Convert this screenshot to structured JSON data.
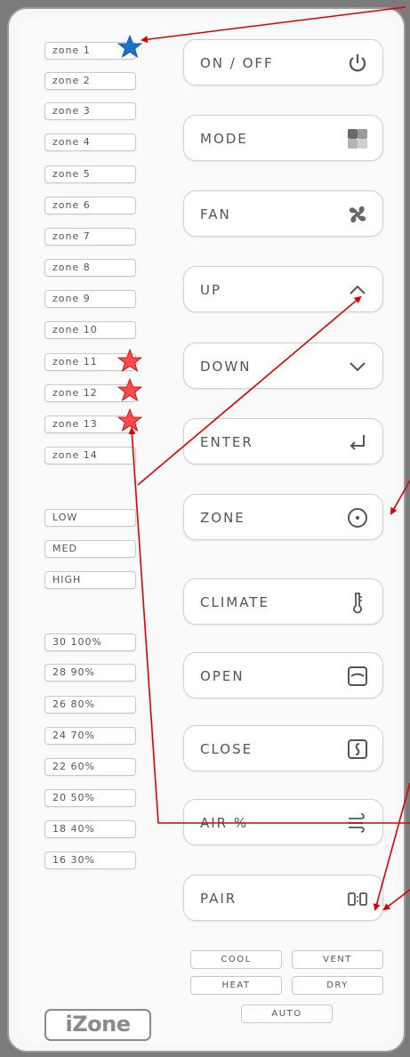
{
  "zones": [
    {
      "label": "zone 1"
    },
    {
      "label": "zone 2"
    },
    {
      "label": "zone 3"
    },
    {
      "label": "zone 4"
    },
    {
      "label": "zone 5"
    },
    {
      "label": "zone 6"
    },
    {
      "label": "zone 7"
    },
    {
      "label": "zone 8"
    },
    {
      "label": "zone 9"
    },
    {
      "label": "zone 10"
    },
    {
      "label": "zone 11"
    },
    {
      "label": "zone 12"
    },
    {
      "label": "zone 13"
    },
    {
      "label": "zone 14"
    }
  ],
  "fan_speeds": [
    {
      "label": "LOW"
    },
    {
      "label": "MED"
    },
    {
      "label": "HIGH"
    }
  ],
  "percentages": [
    {
      "label": "30 100%"
    },
    {
      "label": "28 90%"
    },
    {
      "label": "26 80%"
    },
    {
      "label": "24 70%"
    },
    {
      "label": "22 60%"
    },
    {
      "label": "20 50%"
    },
    {
      "label": "18 40%"
    },
    {
      "label": "16 30%"
    }
  ],
  "controls": {
    "onoff": "ON / OFF",
    "mode": "MODE",
    "fan": "FAN",
    "up": "UP",
    "down": "DOWN",
    "enter": "ENTER",
    "zone": "ZONE",
    "climate": "CLIMATE",
    "open": "OPEN",
    "close": "CLOSE",
    "air": "AIR %",
    "pair": "PAIR"
  },
  "modes": {
    "cool": "COOL",
    "vent": "VENT",
    "heat": "HEAT",
    "dry": "DRY",
    "auto": "AUTO"
  },
  "logo": "iZone",
  "colors": {
    "annotation": "#e00000",
    "star_blue": "#1a73c8",
    "star_red": "#ff4a4a"
  }
}
